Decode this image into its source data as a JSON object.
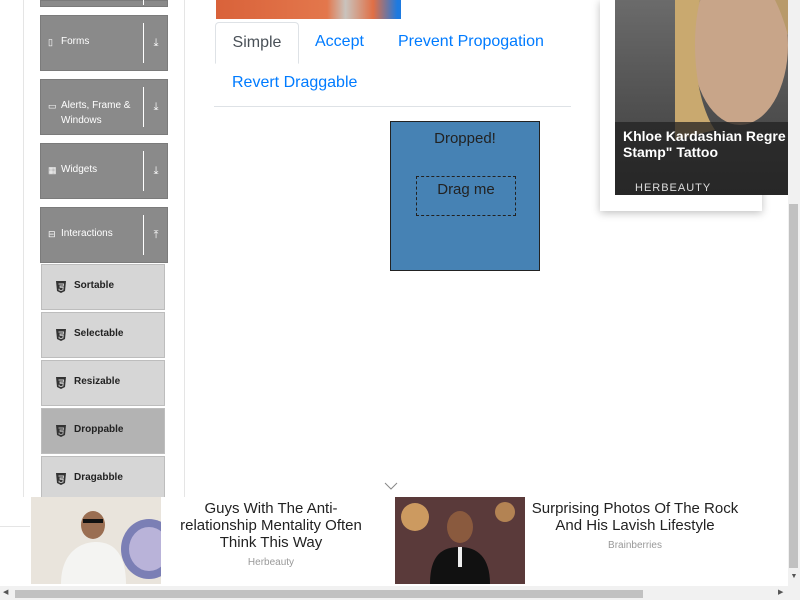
{
  "sidebar": {
    "groups": [
      {
        "label": "Forms",
        "icon": "document-icon",
        "toggle": "⤓"
      },
      {
        "label": "Alerts, Frame & Windows",
        "icon": "window-icon",
        "toggle": "⤓"
      },
      {
        "label": "Widgets",
        "icon": "grid-icon",
        "toggle": "⤓"
      },
      {
        "label": "Interactions",
        "icon": "minus-square-icon",
        "toggle": "⤒"
      }
    ],
    "items": [
      {
        "label": "Sortable"
      },
      {
        "label": "Selectable"
      },
      {
        "label": "Resizable"
      },
      {
        "label": "Droppable"
      },
      {
        "label": "Dragabble"
      }
    ]
  },
  "tabs": [
    {
      "label": "Simple"
    },
    {
      "label": "Accept"
    },
    {
      "label": "Prevent Propogation"
    },
    {
      "label": "Revert Draggable"
    }
  ],
  "droppable": {
    "text": "Dropped!",
    "color": "#4682b4"
  },
  "draggable": {
    "text": "Drag me"
  },
  "ads": {
    "right": {
      "title": "Khloe Kardashian Regre Stamp\" Tattoo",
      "source": "HERBEAUTY"
    },
    "bottom": [
      {
        "title": "Guys With The Anti-relationship Mentality Often Think This Way",
        "source": "Herbeauty"
      },
      {
        "title": "Surprising Photos Of The Rock And His Lavish Lifestyle",
        "source": "Brainberries"
      }
    ]
  },
  "colors": {
    "link": "#007bff",
    "sidebar_group": "#8a8a8a",
    "sidebar_item": "#d6d6d6"
  }
}
